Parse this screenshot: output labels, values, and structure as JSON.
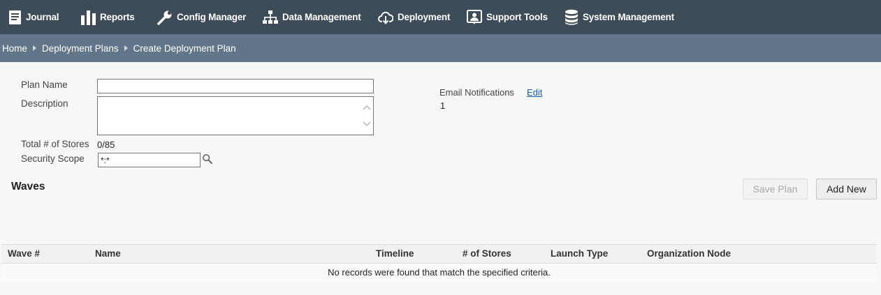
{
  "nav": {
    "items": [
      {
        "label": "Journal",
        "icon": "journal-icon"
      },
      {
        "label": "Reports",
        "icon": "bar-chart-icon"
      },
      {
        "label": "Config Manager",
        "icon": "wrench-icon"
      },
      {
        "label": "Data Management",
        "icon": "hierarchy-icon"
      },
      {
        "label": "Deployment",
        "icon": "cloud-download-icon"
      },
      {
        "label": "Support Tools",
        "icon": "support-person-icon"
      },
      {
        "label": "System Management",
        "icon": "database-icon"
      }
    ]
  },
  "breadcrumb": {
    "items": [
      "Home",
      "Deployment Plans",
      "Create Deployment Plan"
    ]
  },
  "form": {
    "plan_name_label": "Plan Name",
    "plan_name_value": "",
    "description_label": "Description",
    "description_value": "",
    "total_stores_label": "Total # of Stores",
    "total_stores_value": "0/85",
    "security_scope_label": "Security Scope",
    "security_scope_value": "*:*"
  },
  "notifications": {
    "label": "Email Notifications",
    "edit_label": "Edit",
    "count": "1"
  },
  "waves": {
    "title": "Waves",
    "save_label": "Save Plan",
    "add_label": "Add New",
    "columns": [
      "Wave #",
      "Name",
      "Timeline",
      "# of Stores",
      "Launch Type",
      "Organization Node"
    ],
    "empty_message": "No records were found that match the specified criteria."
  },
  "colors": {
    "nav_bg": "#3e4c59",
    "breadcrumb_bg": "#627689",
    "link": "#1a5f9a"
  }
}
